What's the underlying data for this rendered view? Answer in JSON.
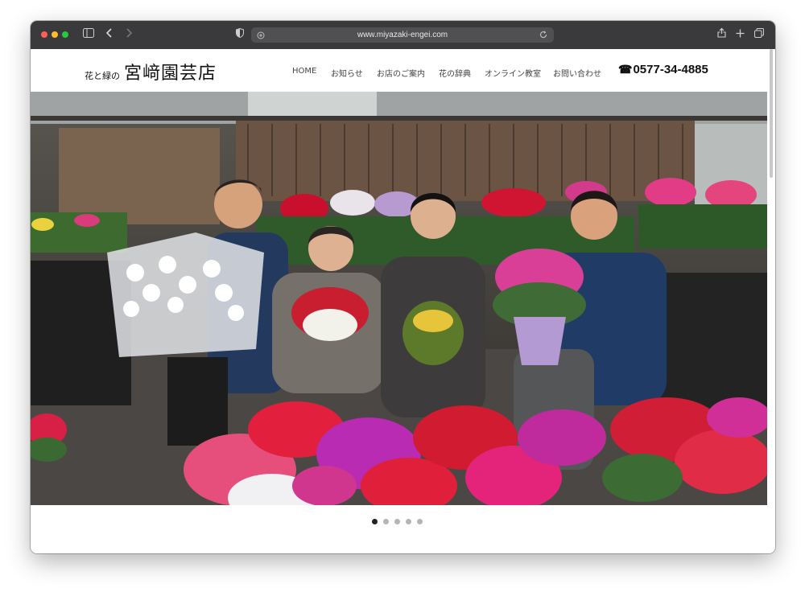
{
  "browser": {
    "url": "www.miyazaki-engei.com",
    "icons": [
      "sidebar-icon",
      "back-icon",
      "forward-icon",
      "shield-icon",
      "site-settings-icon",
      "reload-icon",
      "share-icon",
      "new-tab-icon",
      "tabs-overview-icon"
    ]
  },
  "site": {
    "logo_small": "花と緑の",
    "logo_big": "宮﨑園芸店",
    "nav": [
      "HOME",
      "お知らせ",
      "お店のご案内",
      "花の辞典",
      "オンライン教室",
      "お問い合わせ"
    ],
    "phone_icon": "☎",
    "phone": "0577-34-4885"
  },
  "hero": {
    "slide_count": 5,
    "active_slide": 1,
    "image": "photo of four florists smiling behind potted cyclamen and orchids"
  },
  "colors": {
    "titlebar": "#3a3a3c",
    "urlbar": "#505053",
    "active_dot": "#222222",
    "inactive_dot": "#b5b5b5"
  }
}
